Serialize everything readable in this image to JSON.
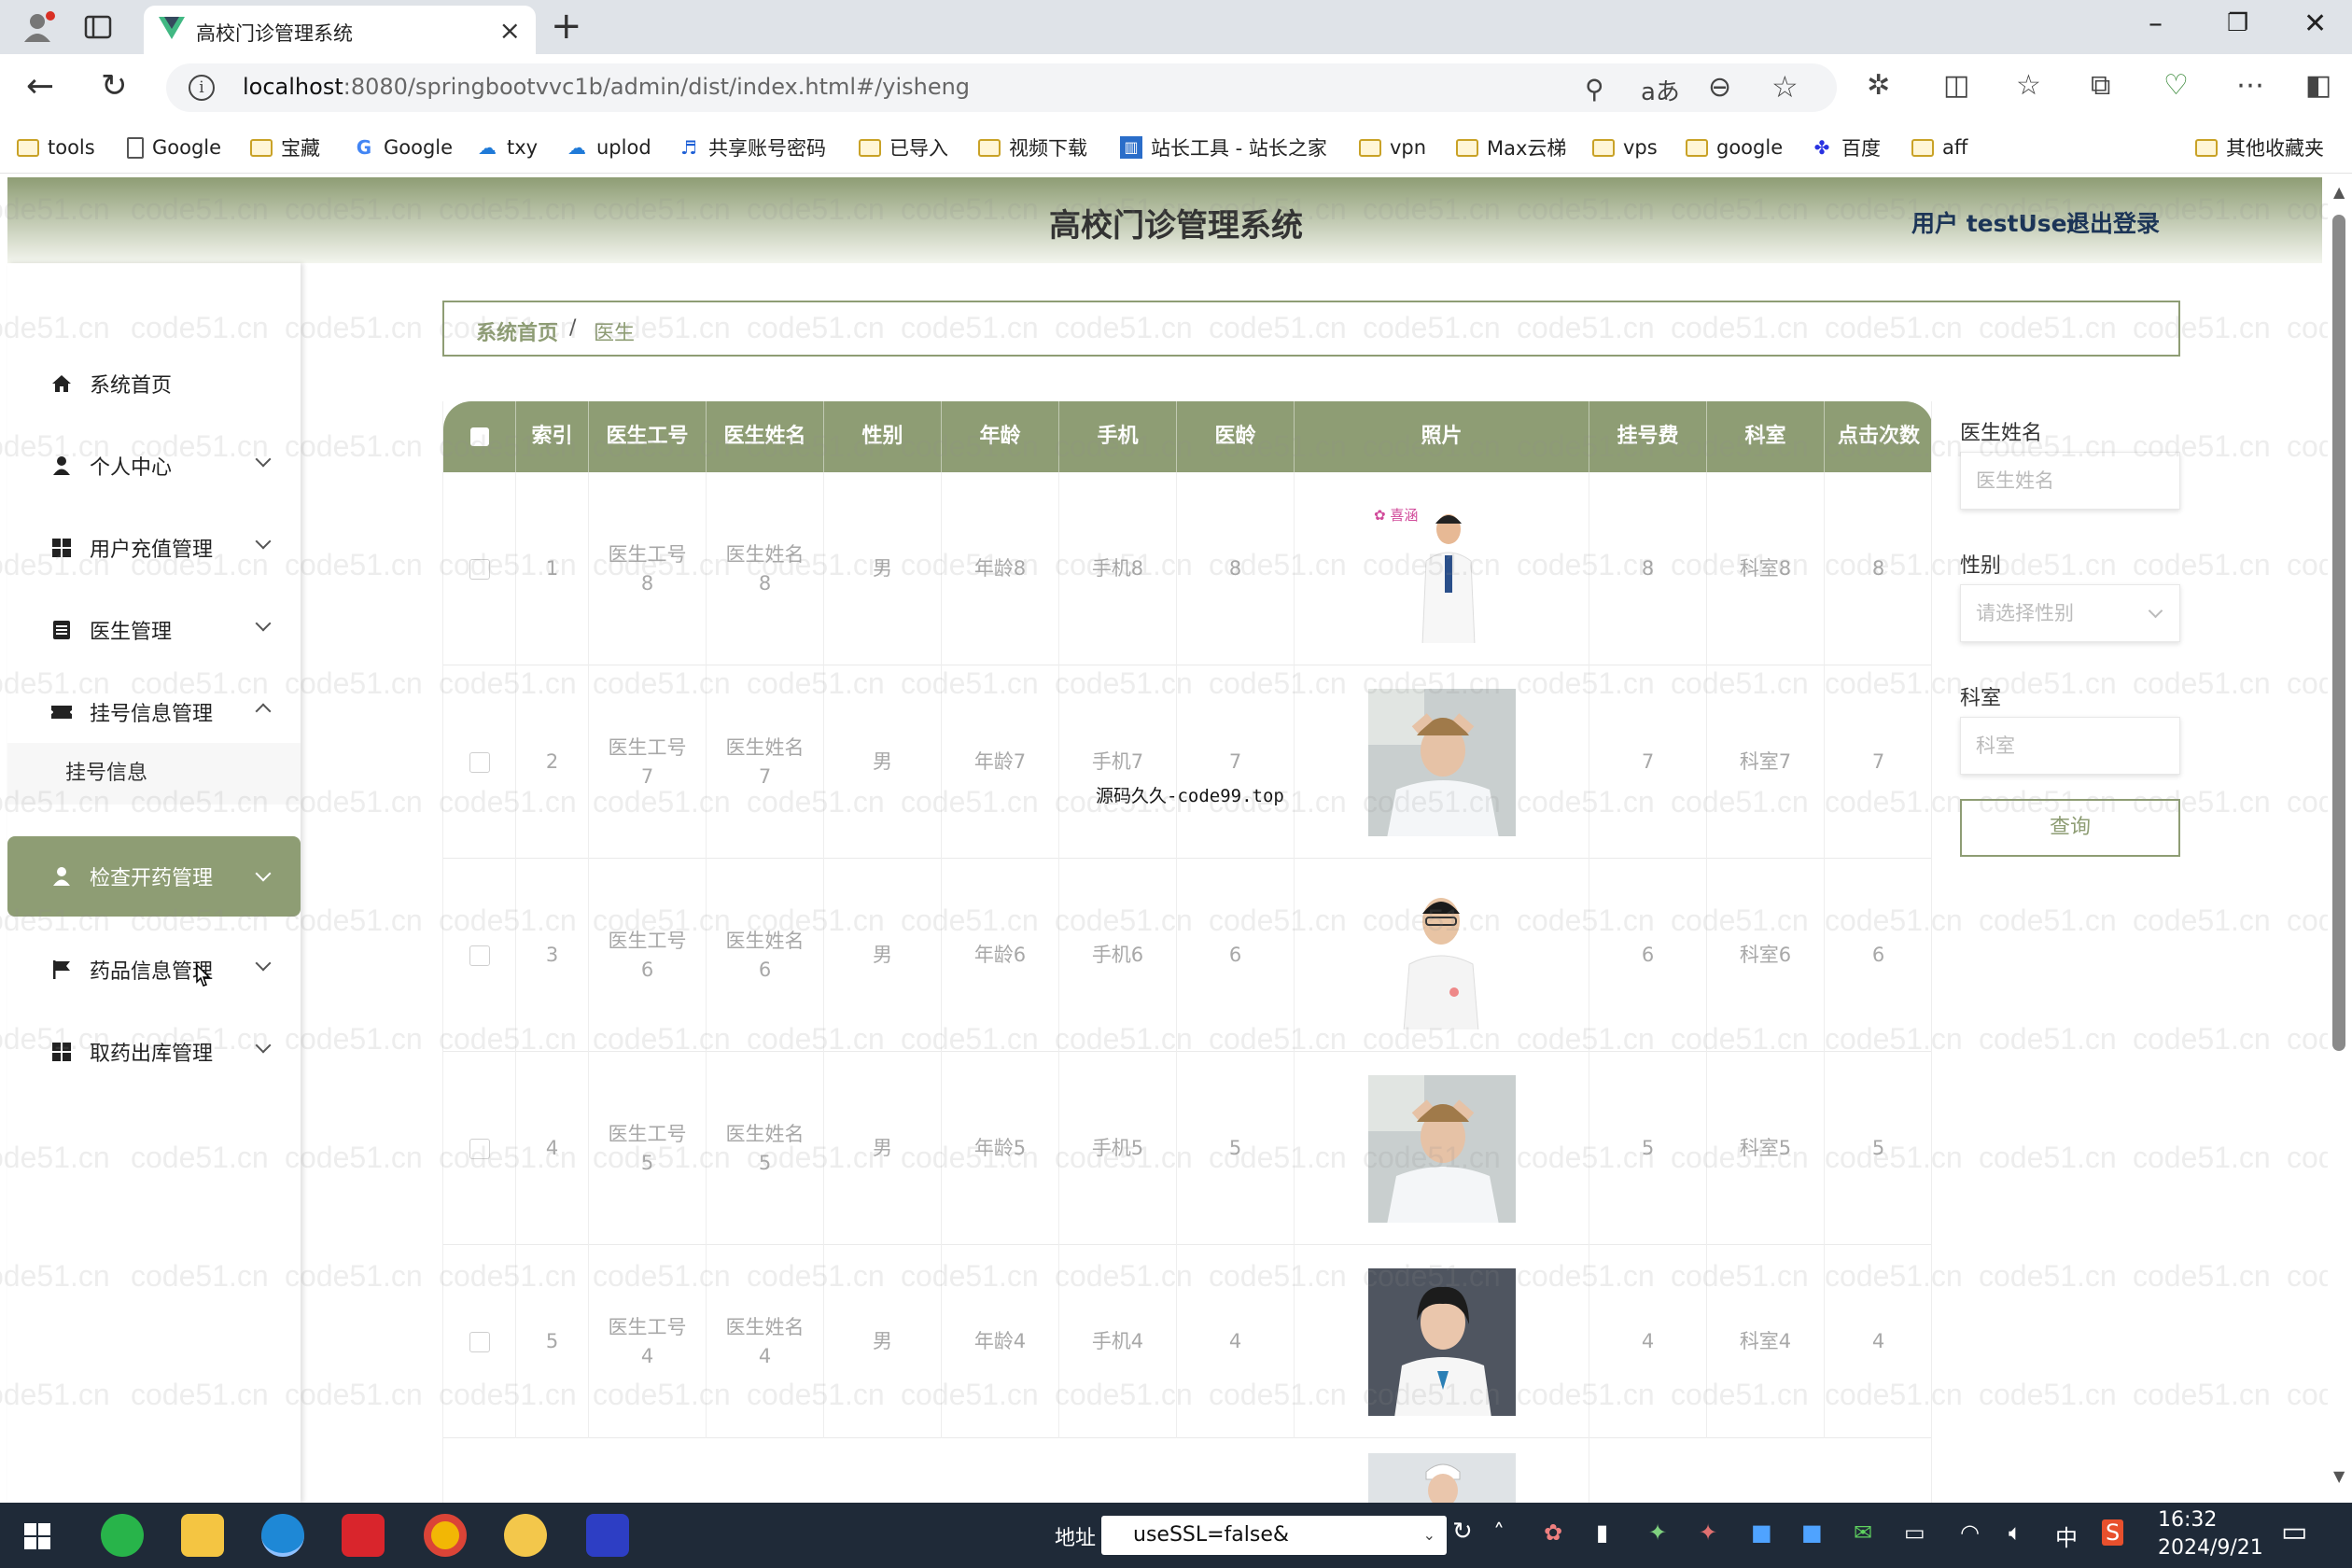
{
  "browser": {
    "tab_title": "高校门诊管理系统",
    "url_host": "localhost",
    "url_rest": ":8080/springbootvvc1b/admin/dist/index.html#/yisheng",
    "bookmarks": [
      "tools",
      "Google",
      "宝藏",
      "Google",
      "txy",
      "uplod",
      "共享账号密码",
      "已导入",
      "视频下载",
      "站长工具 - 站长之家",
      "vpn",
      "Max云梯",
      "vps",
      "google",
      "百度",
      "aff"
    ],
    "other_bookmarks": "其他收藏夹"
  },
  "app": {
    "title": "高校门诊管理系统",
    "user_label": "用户 testUser",
    "logout": "退出登录"
  },
  "sidebar": {
    "items": [
      {
        "label": "系统首页",
        "icon": "home-icon"
      },
      {
        "label": "个人中心",
        "icon": "user-icon"
      },
      {
        "label": "用户充值管理",
        "icon": "grid-icon"
      },
      {
        "label": "医生管理",
        "icon": "document-icon"
      },
      {
        "label": "挂号信息管理",
        "icon": "ticket-icon"
      },
      {
        "label": "检查开药管理",
        "icon": "user-icon"
      },
      {
        "label": "药品信息管理",
        "icon": "flag-icon"
      },
      {
        "label": "取药出库管理",
        "icon": "grid-icon"
      }
    ],
    "submenu": "挂号信息"
  },
  "breadcrumb": {
    "home": "系统首页",
    "sep": "/",
    "current": "医生"
  },
  "table": {
    "columns": [
      "索引",
      "医生工号",
      "医生姓名",
      "性别",
      "年龄",
      "手机",
      "医龄",
      "照片",
      "挂号费",
      "科室",
      "点击次数"
    ],
    "rows": [
      {
        "index": "1",
        "work_id_a": "医生工号",
        "work_id_b": "8",
        "name_a": "医生姓名",
        "name_b": "8",
        "gender": "男",
        "age": "年龄8",
        "phone": "手机8",
        "years": "8",
        "fee": "8",
        "dept": "科室8",
        "clicks": "8"
      },
      {
        "index": "2",
        "work_id_a": "医生工号",
        "work_id_b": "7",
        "name_a": "医生姓名",
        "name_b": "7",
        "gender": "男",
        "age": "年龄7",
        "phone": "手机7",
        "years": "7",
        "fee": "7",
        "dept": "科室7",
        "clicks": "7"
      },
      {
        "index": "3",
        "work_id_a": "医生工号",
        "work_id_b": "6",
        "name_a": "医生姓名",
        "name_b": "6",
        "gender": "男",
        "age": "年龄6",
        "phone": "手机6",
        "years": "6",
        "fee": "6",
        "dept": "科室6",
        "clicks": "6"
      },
      {
        "index": "4",
        "work_id_a": "医生工号",
        "work_id_b": "5",
        "name_a": "医生姓名",
        "name_b": "5",
        "gender": "男",
        "age": "年龄5",
        "phone": "手机5",
        "years": "5",
        "fee": "5",
        "dept": "科室5",
        "clicks": "5"
      },
      {
        "index": "5",
        "work_id_a": "医生工号",
        "work_id_b": "4",
        "name_a": "医生姓名",
        "name_b": "4",
        "gender": "男",
        "age": "年龄4",
        "phone": "手机4",
        "years": "4",
        "fee": "4",
        "dept": "科室4",
        "clicks": "4"
      }
    ]
  },
  "filters": {
    "name_label": "医生姓名",
    "name_placeholder": "医生姓名",
    "gender_label": "性别",
    "gender_placeholder": "请选择性别",
    "dept_label": "科室",
    "dept_placeholder": "科室",
    "query": "查询"
  },
  "overlay_text": "源码久久-code99.top",
  "watermark": "code51.cn",
  "taskbar": {
    "addr_label": "地址",
    "addr_value": "useSSL=false&",
    "ime": "中",
    "time": "16:32",
    "date": "2024/9/21"
  },
  "colors": {
    "theme": "#8e9d74",
    "header_text": "#1c3557"
  }
}
